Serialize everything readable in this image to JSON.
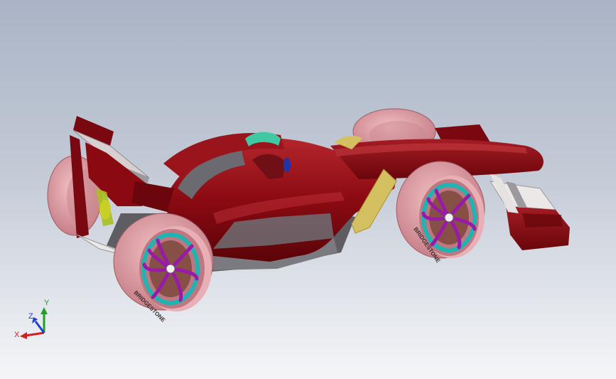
{
  "viewport": {
    "background_top": "#aab4c6",
    "background_bottom": "#f4f5f7"
  },
  "model": {
    "body_color": "#8b0a12",
    "body_highlight": "#b4262c",
    "body_shadow": "#5a0408",
    "underbody_color": "#5e5e62",
    "tire_color": "#e4a0a6",
    "tire_shadow": "#b97078",
    "rim_spoke_color": "#9a1aa8",
    "rim_ring_color": "#20b3b0",
    "hub_color": "#5a3018",
    "mirror_color": "#d4c060",
    "halo_color": "#3fc8a2",
    "front_wing_plate": "#ece8e8",
    "tire_brand_text": "BRIDGESTONE"
  },
  "triad": {
    "x_label": "X",
    "y_label": "Y",
    "z_label": "Z",
    "x_color": "#d02020",
    "y_color": "#20a020",
    "z_color": "#2040d0"
  }
}
